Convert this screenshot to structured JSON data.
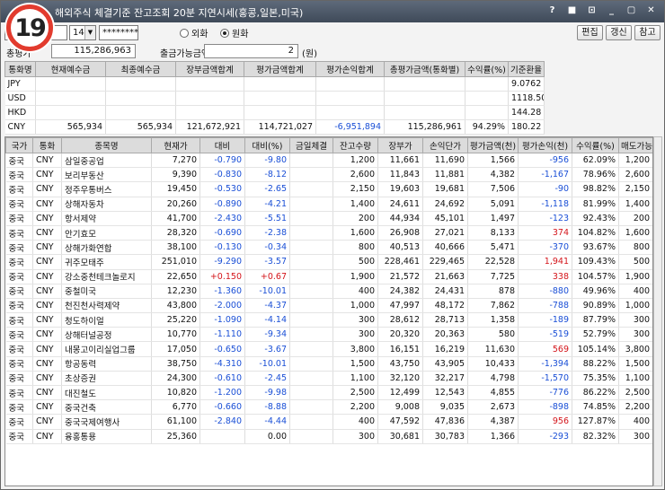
{
  "badge": "19",
  "title": "해외주식 체결기준 잔고조회  20분 지연시세(홍콩,일본,미국)",
  "title_controls": [
    "?",
    "■",
    "⊡",
    "_",
    "▢",
    "✕"
  ],
  "toolbar": {
    "account_value": "",
    "account_suffix": "14",
    "password": "********",
    "radio_foreign": "외화",
    "radio_won": "원화",
    "buttons": [
      "편집",
      "갱신",
      "참고"
    ]
  },
  "summary": {
    "total_label": "총평가",
    "total_value": "115,286,963",
    "withdraw_label": "출금가능금액",
    "withdraw_value": "2",
    "withdraw_unit": "(원)"
  },
  "currency_table": {
    "headers": [
      "통화명",
      "현재예수금",
      "최종예수금",
      "장부금액합계",
      "평가금액합계",
      "평가손익합계",
      "총평가금액(통화별)",
      "수익률(%)",
      "기준환율"
    ],
    "rows": [
      [
        "JPY",
        "",
        "",
        "",
        "",
        "",
        "",
        "",
        "9.0762"
      ],
      [
        "USD",
        "",
        "",
        "",
        "",
        "",
        "",
        "",
        "1118.50"
      ],
      [
        "HKD",
        "",
        "",
        "",
        "",
        "",
        "",
        "",
        "144.28"
      ],
      [
        "CNY",
        "565,934",
        "565,934",
        "121,672,921",
        "114,721,027",
        "-6,951,894",
        "115,286,961",
        "94.29%",
        "180.22"
      ]
    ]
  },
  "holdings": {
    "headers": [
      "국가",
      "통화",
      "종목명",
      "현재가",
      "대비",
      "대비(%)",
      "금일체결",
      "잔고수량",
      "장부가",
      "손익단가",
      "평가금액(천)",
      "평가손익(천)",
      "수익률(%)",
      "매도가능"
    ],
    "rows": [
      [
        "중국",
        "CNY",
        "삼일중공업",
        "7,270",
        "-0.790",
        "-9.80",
        "",
        "1,200",
        "11,661",
        "11,690",
        "1,566",
        "-956",
        "62.09%",
        "1,200"
      ],
      [
        "중국",
        "CNY",
        "보리부동산",
        "9,390",
        "-0.830",
        "-8.12",
        "",
        "2,600",
        "11,843",
        "11,881",
        "4,382",
        "-1,167",
        "78.96%",
        "2,600"
      ],
      [
        "중국",
        "CNY",
        "정주우통버스",
        "19,450",
        "-0.530",
        "-2.65",
        "",
        "2,150",
        "19,603",
        "19,681",
        "7,506",
        "-90",
        "98.82%",
        "2,150"
      ],
      [
        "중국",
        "CNY",
        "상해자동차",
        "20,260",
        "-0.890",
        "-4.21",
        "",
        "1,400",
        "24,611",
        "24,692",
        "5,091",
        "-1,118",
        "81.99%",
        "1,400"
      ],
      [
        "중국",
        "CNY",
        "항서제약",
        "41,700",
        "-2.430",
        "-5.51",
        "",
        "200",
        "44,934",
        "45,101",
        "1,497",
        "-123",
        "92.43%",
        "200"
      ],
      [
        "중국",
        "CNY",
        "안기효모",
        "28,320",
        "-0.690",
        "-2.38",
        "",
        "1,600",
        "26,908",
        "27,021",
        "8,133",
        "374",
        "104.82%",
        "1,600"
      ],
      [
        "중국",
        "CNY",
        "상해가화연합",
        "38,100",
        "-0.130",
        "-0.34",
        "",
        "800",
        "40,513",
        "40,666",
        "5,471",
        "-370",
        "93.67%",
        "800"
      ],
      [
        "중국",
        "CNY",
        "귀주모태주",
        "251,010",
        "-9.290",
        "-3.57",
        "",
        "500",
        "228,461",
        "229,465",
        "22,528",
        "1,941",
        "109.43%",
        "500"
      ],
      [
        "중국",
        "CNY",
        "강소중천테크놀로지",
        "22,650",
        "+0.150",
        "+0.67",
        "",
        "1,900",
        "21,572",
        "21,663",
        "7,725",
        "338",
        "104.57%",
        "1,900"
      ],
      [
        "중국",
        "CNY",
        "중철미국",
        "12,230",
        "-1.360",
        "-10.01",
        "",
        "400",
        "24,382",
        "24,431",
        "878",
        "-880",
        "49.96%",
        "400"
      ],
      [
        "중국",
        "CNY",
        "천진천사력제약",
        "43,800",
        "-2.000",
        "-4.37",
        "",
        "1,000",
        "47,997",
        "48,172",
        "7,862",
        "-788",
        "90.89%",
        "1,000"
      ],
      [
        "중국",
        "CNY",
        "청도하이얼",
        "25,220",
        "-1.090",
        "-4.14",
        "",
        "300",
        "28,612",
        "28,713",
        "1,358",
        "-189",
        "87.79%",
        "300"
      ],
      [
        "중국",
        "CNY",
        "상해터널공정",
        "10,770",
        "-1.110",
        "-9.34",
        "",
        "300",
        "20,320",
        "20,363",
        "580",
        "-519",
        "52.79%",
        "300"
      ],
      [
        "중국",
        "CNY",
        "내몽고이리실업그룹",
        "17,050",
        "-0.650",
        "-3.67",
        "",
        "3,800",
        "16,151",
        "16,219",
        "11,630",
        "569",
        "105.14%",
        "3,800"
      ],
      [
        "중국",
        "CNY",
        "항공동력",
        "38,750",
        "-4.310",
        "-10.01",
        "",
        "1,500",
        "43,750",
        "43,905",
        "10,433",
        "-1,394",
        "88.22%",
        "1,500"
      ],
      [
        "중국",
        "CNY",
        "초상증권",
        "24,300",
        "-0.610",
        "-2.45",
        "",
        "1,100",
        "32,120",
        "32,217",
        "4,798",
        "-1,570",
        "75.35%",
        "1,100"
      ],
      [
        "중국",
        "CNY",
        "대진철도",
        "10,820",
        "-1.200",
        "-9.98",
        "",
        "2,500",
        "12,499",
        "12,543",
        "4,855",
        "-776",
        "86.22%",
        "2,500"
      ],
      [
        "중국",
        "CNY",
        "중국건축",
        "6,770",
        "-0.660",
        "-8.88",
        "",
        "2,200",
        "9,008",
        "9,035",
        "2,673",
        "-898",
        "74.85%",
        "2,200"
      ],
      [
        "중국",
        "CNY",
        "중국국제여행사",
        "61,100",
        "-2.840",
        "-4.44",
        "",
        "400",
        "47,592",
        "47,836",
        "4,387",
        "956",
        "127.87%",
        "400"
      ],
      [
        "중국",
        "CNY",
        "융홍통용",
        "25,360",
        "",
        "0.00",
        "",
        "300",
        "30,681",
        "30,783",
        "1,366",
        "-293",
        "82.32%",
        "300"
      ]
    ]
  },
  "colors": {
    "negative": "#1a4fd6",
    "positive": "#d4141a",
    "badge_ring": "#e23b2e",
    "titlebar": "#4b5666"
  }
}
